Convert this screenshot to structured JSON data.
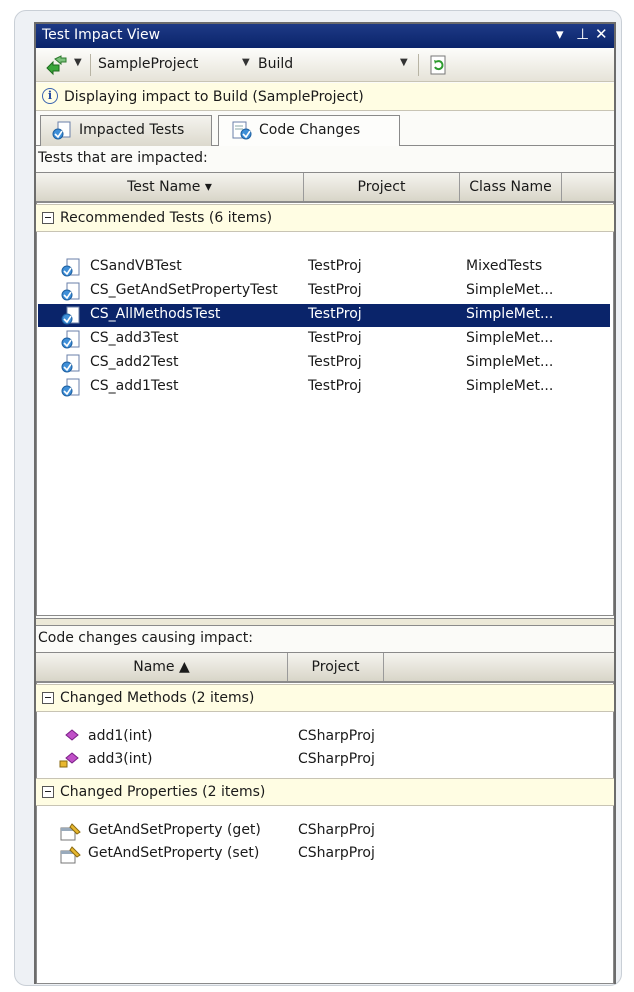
{
  "window": {
    "title": "Test Impact View",
    "controls": [
      "▾",
      "⊥",
      "✕"
    ]
  },
  "toolbar": {
    "project_value": "SampleProject",
    "build_value": "Build"
  },
  "info": {
    "message": "Displaying impact to Build (SampleProject)"
  },
  "tabs": [
    {
      "label": "Impacted Tests",
      "active": true
    },
    {
      "label": "Code Changes",
      "active": false
    }
  ],
  "impacted": {
    "section_label": "Tests that are impacted:",
    "columns": [
      {
        "label": "Test Name ▾"
      },
      {
        "label": "Project"
      },
      {
        "label": "Class Name"
      }
    ],
    "group_label": "Recommended Tests (6 items)",
    "rows": [
      {
        "name": "CSandVBTest",
        "project": "TestProj",
        "class": "MixedTests",
        "selected": false
      },
      {
        "name": "CS_GetAndSetPropertyTest",
        "project": "TestProj",
        "class": "SimpleMet...",
        "selected": false
      },
      {
        "name": "CS_AllMethodsTest",
        "project": "TestProj",
        "class": "SimpleMet...",
        "selected": true
      },
      {
        "name": "CS_add3Test",
        "project": "TestProj",
        "class": "SimpleMet...",
        "selected": false
      },
      {
        "name": "CS_add2Test",
        "project": "TestProj",
        "class": "SimpleMet...",
        "selected": false
      },
      {
        "name": "CS_add1Test",
        "project": "TestProj",
        "class": "SimpleMet...",
        "selected": false
      }
    ]
  },
  "changes": {
    "section_label": "Code changes causing impact:",
    "columns": [
      {
        "label": "Name ▲"
      },
      {
        "label": "Project"
      }
    ],
    "method_group_label": "Changed Methods (2 items)",
    "methods": [
      {
        "name": "add1(int)",
        "project": "CSharpProj"
      },
      {
        "name": "add3(int)",
        "project": "CSharpProj"
      }
    ],
    "property_group_label": "Changed Properties (2 items)",
    "properties": [
      {
        "name": "GetAndSetProperty (get)",
        "project": "CSharpProj"
      },
      {
        "name": "GetAndSetProperty (set)",
        "project": "CSharpProj"
      }
    ]
  },
  "colors": {
    "title_bar": "#0a246a",
    "selection": "#0a246a",
    "group_background": "#fffde3"
  },
  "icons": {
    "run": "run-tests-icon",
    "refresh": "refresh-icon",
    "info": "info-icon",
    "impacted_tab": "impacted-tests-icon",
    "code_changes_tab": "code-changes-icon",
    "test": "test-icon",
    "method": "method-icon",
    "property": "property-icon"
  }
}
